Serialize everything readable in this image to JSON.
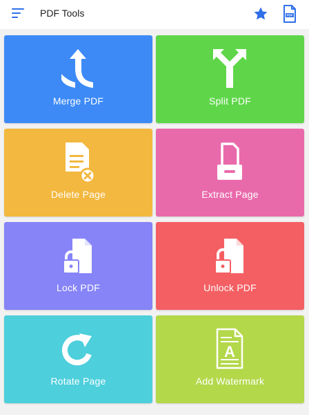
{
  "appbar": {
    "title": "PDF Tools",
    "menu_icon": "menu-icon",
    "favorite_icon": "star-icon",
    "pdf_file_icon": "pdf-file-icon",
    "file_icon_text": "PDF",
    "accent_color": "#2f6fe8"
  },
  "tools": [
    {
      "label": "Merge PDF",
      "icon": "merge-arrows-icon",
      "color": "#3d8af7"
    },
    {
      "label": "Split PDF",
      "icon": "split-arrows-icon",
      "color": "#5fd64a"
    },
    {
      "label": "Delete Page",
      "icon": "delete-document-icon",
      "color": "#f3b83f"
    },
    {
      "label": "Extract Page",
      "icon": "extract-tray-icon",
      "color": "#e96aab"
    },
    {
      "label": "Lock PDF",
      "icon": "lock-document-icon",
      "color": "#8684f7"
    },
    {
      "label": "Unlock PDF",
      "icon": "unlock-document-icon",
      "color": "#f45f63"
    },
    {
      "label": "Rotate Page",
      "icon": "rotate-clockwise-icon",
      "color": "#4dcfdc"
    },
    {
      "label": "Add Watermark",
      "icon": "watermark-document-icon",
      "color": "#b3d84a",
      "watermark_letter": "A"
    }
  ]
}
